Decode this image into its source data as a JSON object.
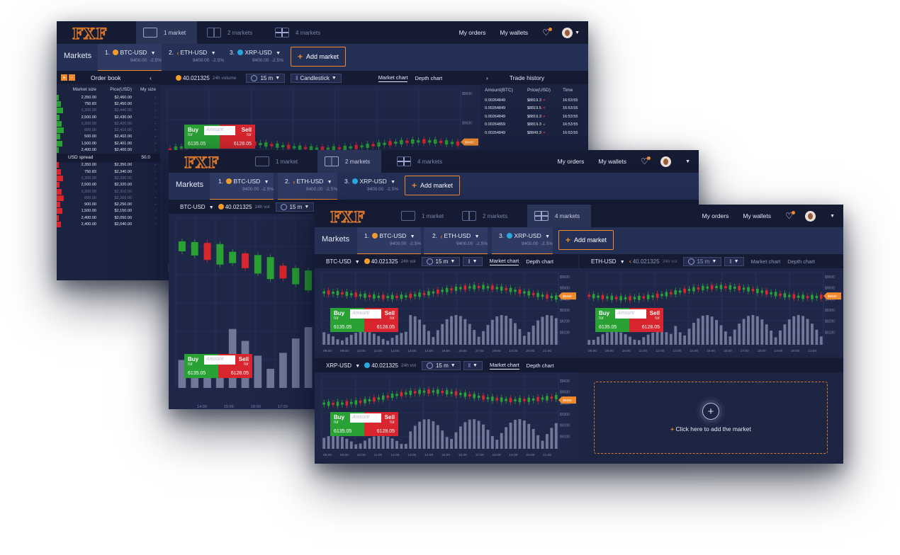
{
  "app": {
    "logo": "FXF"
  },
  "views": {
    "one": "1 market",
    "two": "2 markets",
    "four": "4 markets"
  },
  "top": {
    "orders": "My orders",
    "wallets": "My wallets"
  },
  "markets_label": "Markets",
  "markets": [
    {
      "num": "1.",
      "name": "BTC-USD",
      "price": "9400.00",
      "change": "-2.5%"
    },
    {
      "num": "2.",
      "name": "ETH-USD",
      "price": "9400.00",
      "change": "-2.5%"
    },
    {
      "num": "3.",
      "name": "XRP-USD",
      "price": "9400.00",
      "change": "-2.5%"
    }
  ],
  "add_market": "Add market",
  "toolbar": {
    "volume": "40.021325",
    "volume_label_long": "24h volume",
    "volume_label_short": "24h vol",
    "interval": "15 m",
    "chart_type": "Candlestick",
    "market_chart": "Market chart",
    "depth_chart": "Depth chart"
  },
  "pairs": {
    "btc": "BTC-USD",
    "eth": "ETH-USD",
    "xrp": "XRP-USD"
  },
  "trade": {
    "buy": "Buy",
    "sell": "Sell",
    "for": "for",
    "amount_placeholder": "Amount",
    "buy_price": "6135.05",
    "sell_price": "6128.05"
  },
  "orderbook": {
    "title": "Order book",
    "cols": [
      "Market size",
      "Pice(USD)",
      "My size"
    ],
    "asks": [
      [
        "2,350.00",
        "$2,460.00"
      ],
      [
        "750.83",
        "$2,450.00"
      ],
      [
        "1,200.00",
        "$2,440.00"
      ],
      [
        "2,500.00",
        "$2,430.00"
      ],
      [
        "3,200.00",
        "$2,420.00"
      ],
      [
        "850.00",
        "$2,410.00"
      ],
      [
        "500.00",
        "$2,402.00"
      ],
      [
        "1,500.00",
        "$2,401.00"
      ],
      [
        "2,400.00",
        "$2,400.00"
      ]
    ],
    "spread_label": "USD spread",
    "spread_value": "50.0",
    "bids": [
      [
        "2,350.00",
        "$2,350.00"
      ],
      [
        "750.83",
        "$2,340.00"
      ],
      [
        "1,200.00",
        "$2,330.00"
      ],
      [
        "2,500.00",
        "$2,320.00"
      ],
      [
        "3,200.00",
        "$2,310.00"
      ],
      [
        "850.00",
        "$2,300.00"
      ],
      [
        "900.00",
        "$2,250.00"
      ],
      [
        "1,500.00",
        "$2,150.00"
      ],
      [
        "2,400.00",
        "$2,050.00"
      ],
      [
        "2,400.00",
        "$2,040.00"
      ]
    ],
    "dash": "-"
  },
  "trade_history": {
    "title": "Trade history",
    "cols": [
      "Amount(BTC)",
      "Price(USD)",
      "Time"
    ],
    "rows": [
      {
        "amount": "0.00264849",
        "price": "$8819.3",
        "dir": "down",
        "time": "16:53:55"
      },
      {
        "amount": "0.00264849",
        "price": "$8819.5",
        "dir": "down",
        "time": "16:53:55"
      },
      {
        "amount": "0.00264849",
        "price": "$8819.3",
        "dir": "down",
        "time": "16:53:55"
      },
      {
        "amount": "0.00264859",
        "price": "$8819.3",
        "dir": "up",
        "time": "16:53:55"
      },
      {
        "amount": "0.00264849",
        "price": "$8849.3",
        "dir": "down",
        "time": "16:53:55"
      }
    ]
  },
  "price_axis": [
    "$9600",
    "$9500",
    "$9400",
    "$9300",
    "$9200",
    "$9100"
  ],
  "current_price_tag": "$9460",
  "time_axis": [
    "08:00",
    "09:00",
    "10:00",
    "11:00",
    "12:00",
    "13:00",
    "14:00",
    "15:00",
    "16:00",
    "17:00",
    "18:00",
    "19:00",
    "20:00",
    "21:00"
  ],
  "time_axis_w2": [
    "14:00",
    "15:00",
    "16:00",
    "17:00"
  ],
  "add_slot_text": "Click here to add the market",
  "colors": {
    "accent": "#f08a2d",
    "up": "#2aa135",
    "down": "#d9262e",
    "bg": "#1d2542"
  }
}
